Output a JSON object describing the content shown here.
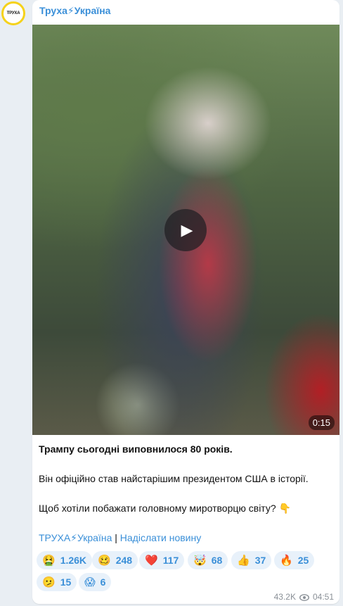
{
  "channel": {
    "avatar_text": "ТРУХА",
    "name": "Труха⚡Україна"
  },
  "media": {
    "duration": "0:15",
    "play_icon": "play-icon"
  },
  "post": {
    "line1": "Трампу сьогодні виповнилося 80 років.",
    "line2": "Він офіційно став найстарішим президентом США в історії.",
    "line3": "Щоб хотіли побажати головному миротворцю світу? 👇",
    "link1": "ТРУХА⚡Україна",
    "separator": "|",
    "link2": "Надіслати новину"
  },
  "reactions": [
    {
      "emoji": "🤮",
      "count": "1.26K"
    },
    {
      "emoji": "🥴",
      "count": "248"
    },
    {
      "emoji": "❤️",
      "count": "117"
    },
    {
      "emoji": "🤯",
      "count": "68"
    },
    {
      "emoji": "👍",
      "count": "37"
    },
    {
      "emoji": "🔥",
      "count": "25"
    },
    {
      "emoji": "🫤",
      "count": "15"
    },
    {
      "emoji": "😱",
      "count": "6"
    }
  ],
  "meta": {
    "views": "43.2K",
    "time": "04:51"
  },
  "colors": {
    "accent": "#3a8fd8",
    "reaction_bg": "#e8f1fa",
    "avatar_ring": "#f5d21b"
  }
}
